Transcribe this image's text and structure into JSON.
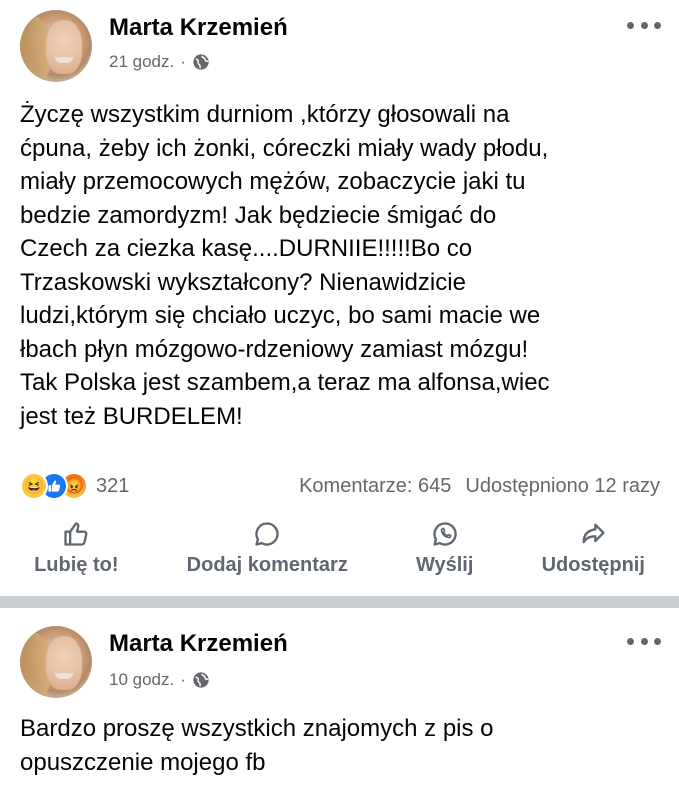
{
  "posts": [
    {
      "author": "Marta Krzemień",
      "time": "21 godz.",
      "separator": "·",
      "text": "Życzę wszystkim durniom ,którzy głosowali na\nćpuna, żeby ich żonki, córeczki miały wady płodu,\nmiały przemocowych mężów, zobaczycie jaki tu\nbedzie zamordyzm! Jak będziecie śmigać do\nCzech za ciezka kasę....DURNIIE!!!!!Bo co\nTrzaskowski wykształcony? Nienawidzicie\nludzi,którym się chciało uczyc, bo sami macie we\nłbach płyn mózgowo-rdzeniowy zamiast mózgu!\nTak Polska jest szambem,a teraz ma alfonsa,wiec\njest też BURDELEM!",
      "reactions": {
        "icons": [
          "haha",
          "like",
          "angry"
        ],
        "count": "321"
      },
      "comments": "Komentarze: 645",
      "shares": "Udostępniono 12 razy",
      "actions": {
        "like": "Lubię to!",
        "comment": "Dodaj komentarz",
        "send": "Wyślij",
        "share": "Udostępnij"
      }
    },
    {
      "author": "Marta Krzemień",
      "time": "10 godz.",
      "separator": "·",
      "text": "Bardzo proszę wszystkich znajomych z pis o\nopuszczenie mojego fb"
    }
  ],
  "colors": {
    "text": "#050505",
    "secondary": "#65676b",
    "like_blue": "#1877f2",
    "divider": "#c9ccd1"
  }
}
